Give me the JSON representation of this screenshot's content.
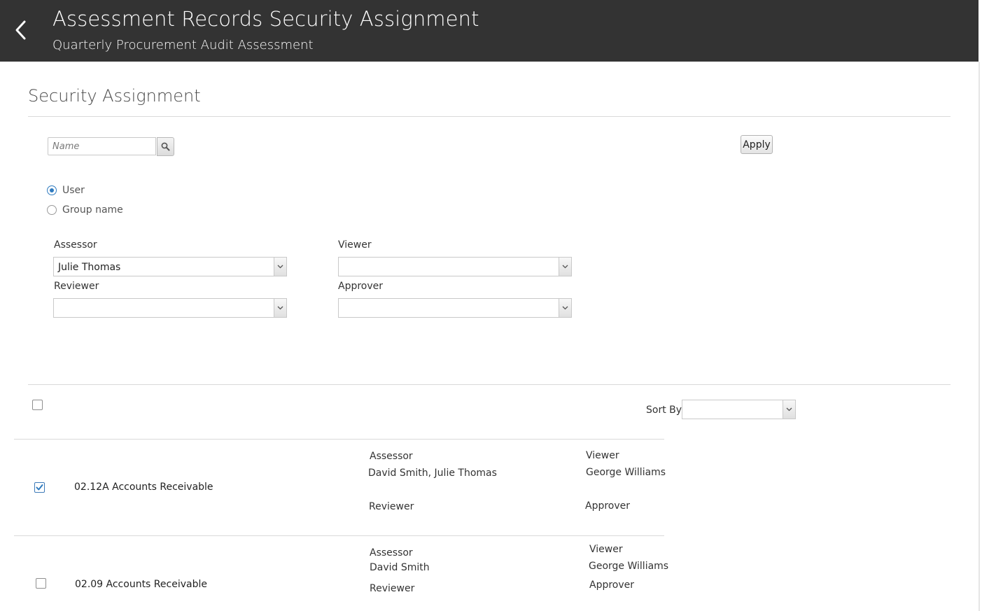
{
  "header": {
    "title": "Assessment Records Security Assignment",
    "subtitle": "Quarterly Procurement Audit Assessment"
  },
  "section": {
    "title": "Security Assignment"
  },
  "search": {
    "placeholder": "Name",
    "value": ""
  },
  "apply_label": "Apply",
  "radio": {
    "options": [
      {
        "label": "User",
        "selected": true
      },
      {
        "label": "Group name",
        "selected": false
      }
    ]
  },
  "roles": {
    "assessor": {
      "label": "Assessor",
      "value": "Julie Thomas"
    },
    "viewer": {
      "label": "Viewer",
      "value": ""
    },
    "reviewer": {
      "label": "Reviewer",
      "value": ""
    },
    "approver": {
      "label": "Approver",
      "value": ""
    }
  },
  "list": {
    "select_all_checked": false,
    "sort_by_label": "Sort By",
    "sort_by_value": "",
    "records": [
      {
        "name": "02.12A Accounts Receivable",
        "checked": true,
        "assessor_label": "Assessor",
        "assessor_value": "David Smith, Julie Thomas",
        "viewer_label": "Viewer",
        "viewer_value": "George Williams",
        "reviewer_label": "Reviewer",
        "approver_label": "Approver"
      },
      {
        "name": "02.09 Accounts Receivable",
        "checked": false,
        "assessor_label": "Assessor",
        "assessor_value": "David Smith",
        "viewer_label": "Viewer",
        "viewer_value": "George Williams",
        "reviewer_label": "Reviewer",
        "approver_label": "Approver"
      }
    ]
  },
  "colors": {
    "header_bg": "#333333",
    "accent": "#2f7bbf",
    "divider": "#d9d9d9"
  }
}
